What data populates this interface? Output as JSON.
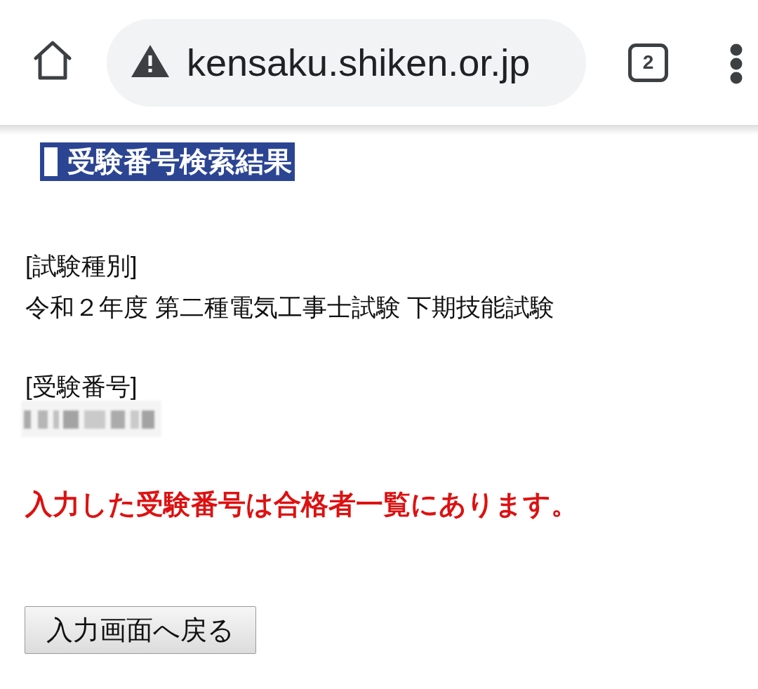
{
  "toolbar": {
    "secure": false,
    "url": "kensaku.shiken.or.jp",
    "tab_count": "2"
  },
  "heading": "受験番号検索結果",
  "fields": [
    {
      "label": "[試験種別]",
      "value": "令和２年度 第二種電気工事士試験 下期技能試験",
      "obscured": false
    },
    {
      "label": "[受験番号]",
      "obscured": true
    }
  ],
  "message": "入力した受験番号は合格者一覧にあります。",
  "buttons": [
    "入力画面へ戻る"
  ]
}
